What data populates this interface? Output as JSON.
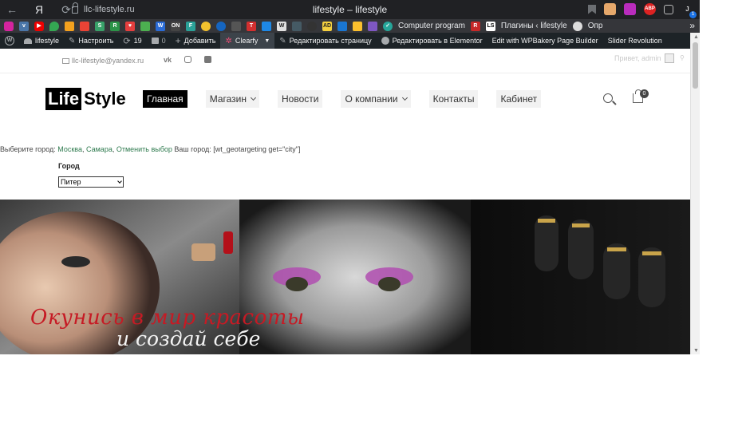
{
  "browser": {
    "url": "llc-lifestyle.ru",
    "page_title": "lifestyle – lifestyle",
    "nav_back": "←",
    "nav_yandex": "Я",
    "nav_reload": "⟳",
    "ext_abp": "ABP",
    "notif_count": "1"
  },
  "bookmarks": {
    "computer": "Computer program",
    "plugins": "Плагины ‹ lifestyle",
    "options": "Опр",
    "overflow": "»"
  },
  "adminbar": {
    "site": "lifestyle",
    "customize": "Настроить",
    "updates": "19",
    "comments": "0",
    "add_new": "Добавить",
    "clearfy": "Clearfy",
    "edit_page": "Редактировать страницу",
    "edit_elementor": "Редактировать в Elementor",
    "wpbakery": "Edit with WPBakery Page Builder",
    "slider": "Slider Revolution"
  },
  "topbar": {
    "email": "llc-lifestyle@yandex.ru",
    "vk": "vk",
    "greeting": "Привет, admin"
  },
  "header": {
    "logo_part1": "Life",
    "logo_part2": "Style",
    "nav": [
      {
        "label": "Главная"
      },
      {
        "label": "Магазин"
      },
      {
        "label": "Новости"
      },
      {
        "label": "О компании"
      },
      {
        "label": "Контакты"
      },
      {
        "label": "Кабинет"
      }
    ],
    "cart_count": "0"
  },
  "geo": {
    "prefix": "Выберите город:",
    "city1": "Москва",
    "city2": "Самара",
    "cancel": "Отменить выбор",
    "your_city": "Ваш город: [wt_geotargeting get=\"city\"]",
    "sep": ", ",
    "city_label": "Город",
    "selected_city": "Питер"
  },
  "banner": {
    "slogan_line1": "Окунись в мир красоты",
    "slogan_line2": "и создай себе"
  }
}
